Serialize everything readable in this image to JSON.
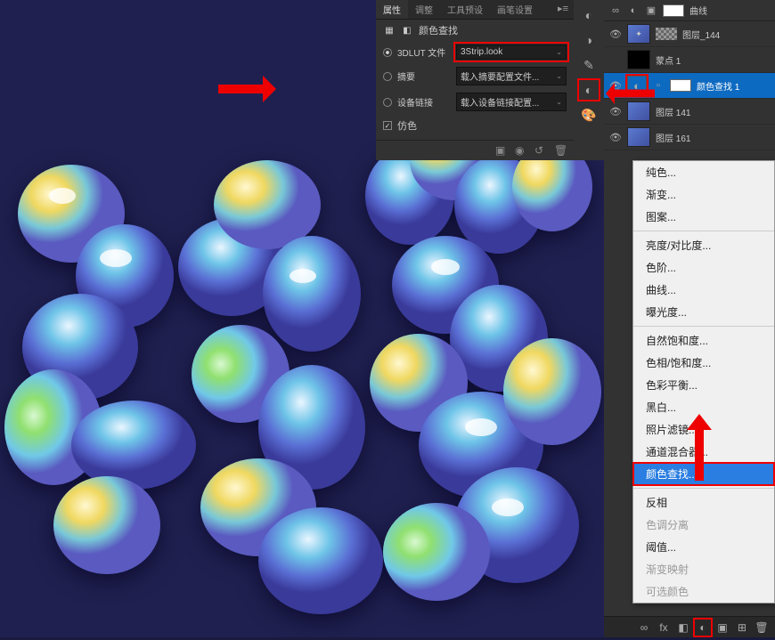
{
  "panel_tabs": {
    "properties": "属性",
    "adjustments": "调整",
    "tool_presets": "工具预设",
    "brush_settings": "画笔设置"
  },
  "properties": {
    "title": "颜色查找",
    "rows": {
      "lut_label": "3DLUT 文件",
      "lut_value": "3Strip.look",
      "abstract_label": "摘要",
      "abstract_value": "载入摘要配置文件...",
      "device_label": "设备链接",
      "device_value": "载入设备链接配置...",
      "dither_label": "仿色"
    }
  },
  "layers": {
    "header_name": "曲线",
    "items": [
      {
        "name": "图层_144",
        "visible": true
      },
      {
        "name": "蒙点 1",
        "visible": false
      },
      {
        "name": "颜色查找 1",
        "visible": true,
        "active": true,
        "adjustment": true
      },
      {
        "name": "图层 141",
        "visible": true
      },
      {
        "name": "图层 161",
        "visible": true
      }
    ]
  },
  "context_menu": {
    "items": [
      {
        "label": "纯色...",
        "group": 1
      },
      {
        "label": "渐变...",
        "group": 1
      },
      {
        "label": "图案...",
        "group": 1
      },
      {
        "label": "亮度/对比度...",
        "group": 2
      },
      {
        "label": "色阶...",
        "group": 2
      },
      {
        "label": "曲线...",
        "group": 2
      },
      {
        "label": "曝光度...",
        "group": 2
      },
      {
        "label": "自然饱和度...",
        "group": 3
      },
      {
        "label": "色相/饱和度...",
        "group": 3
      },
      {
        "label": "色彩平衡...",
        "group": 3
      },
      {
        "label": "黑白...",
        "group": 3
      },
      {
        "label": "照片滤镜...",
        "group": 3
      },
      {
        "label": "通道混合器...",
        "group": 3
      },
      {
        "label": "颜色查找...",
        "group": 3,
        "selected": true,
        "highlight": true
      },
      {
        "label": "反相",
        "group": 4
      },
      {
        "label": "色调分离",
        "group": 4,
        "disabled": true
      },
      {
        "label": "阈值...",
        "group": 4
      },
      {
        "label": "渐变映射",
        "group": 4,
        "disabled": true
      },
      {
        "label": "可选颜色",
        "group": 4,
        "disabled": true
      }
    ]
  }
}
